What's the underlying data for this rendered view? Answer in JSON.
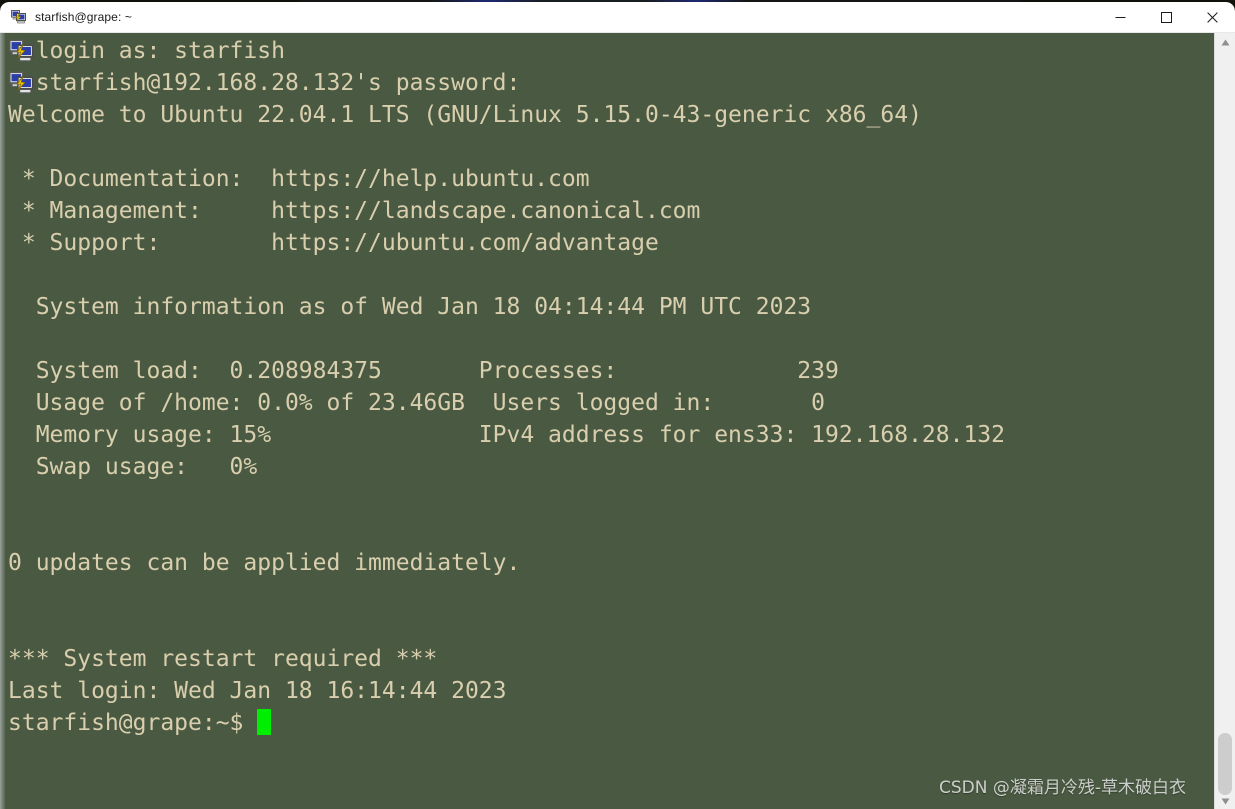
{
  "window": {
    "title": "starfish@grape: ~",
    "title_icon": "putty-icon",
    "controls": {
      "minimize_label": "Minimize",
      "maximize_label": "Maximize",
      "close_label": "Close"
    }
  },
  "terminal": {
    "background_color": "#4a5a42",
    "text_color": "#d9cfae",
    "cursor_color": "#00ee00",
    "lines": [
      "  login as: starfish",
      "  starfish@192.168.28.132's password:",
      "Welcome to Ubuntu 22.04.1 LTS (GNU/Linux 5.15.0-43-generic x86_64)",
      "",
      " * Documentation:  https://help.ubuntu.com",
      " * Management:     https://landscape.canonical.com",
      " * Support:        https://ubuntu.com/advantage",
      "",
      "  System information as of Wed Jan 18 04:14:44 PM UTC 2023",
      "",
      "  System load:  0.208984375       Processes:             239",
      "  Usage of /home: 0.0% of 23.46GB  Users logged in:       0",
      "  Memory usage: 15%               IPv4 address for ens33: 192.168.28.132",
      "  Swap usage:   0%",
      "",
      "",
      "0 updates can be applied immediately.",
      "",
      "",
      "*** System restart required ***",
      "Last login: Wed Jan 18 16:14:44 2023"
    ],
    "prompt": "starfish@grape:~$ ",
    "overlay_icons": [
      "putty-icon",
      "putty-icon"
    ]
  },
  "scrollbar": {
    "up_arrow": "scroll-up-arrow-icon",
    "down_arrow": "scroll-down-arrow-icon",
    "thumb_label": "scroll-thumb"
  },
  "watermark": {
    "text": "CSDN @凝霜月冷残-草木破白衣"
  }
}
